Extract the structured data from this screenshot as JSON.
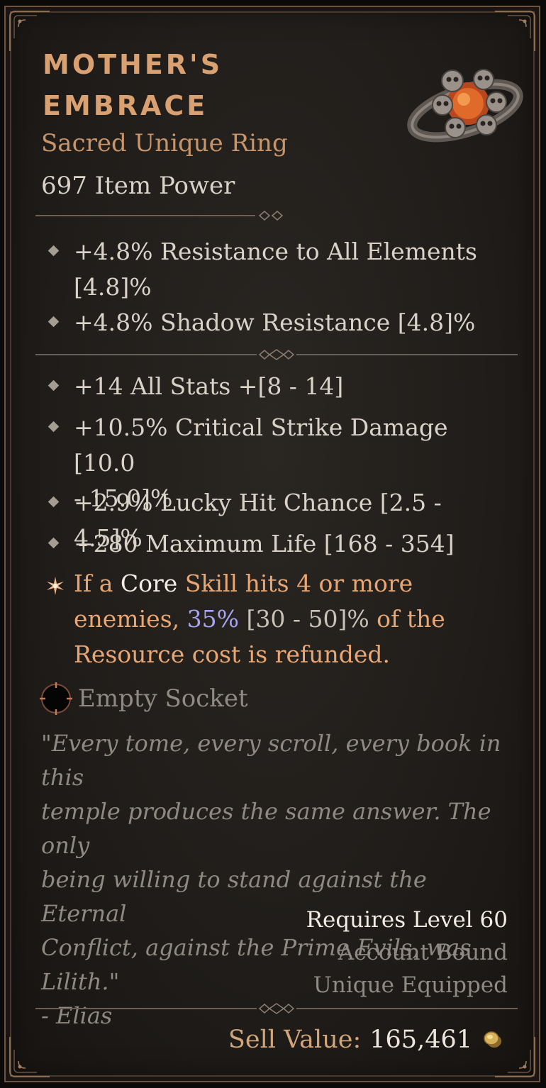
{
  "item": {
    "name_line1": "Mother's",
    "name_line2": "Embrace",
    "type": "Sacred Unique Ring",
    "item_power": "697 Item Power",
    "image_icon": "skull-ring-icon"
  },
  "implicit_affixes": [
    {
      "text_line1": "+4.8% Resistance to All Elements",
      "text_line2": "[4.8]%"
    },
    {
      "text": "+4.8% Shadow Resistance [4.8]%"
    }
  ],
  "affixes": [
    {
      "text": "+14 All Stats +[8 - 14]"
    },
    {
      "text_line1": "+10.5% Critical Strike Damage [10.0",
      "text_line2": "- 15.0]%"
    },
    {
      "text": "+2.9% Lucky Hit Chance [2.5 - 4.5]%"
    },
    {
      "text": "+280 Maximum Life [168 - 354]"
    }
  ],
  "unique_power": {
    "p1": "If a ",
    "core": "Core",
    "p2": " Skill hits 4 or more",
    "p3": "enemies, ",
    "roll": "35%",
    "range": " [30 - 50]%",
    "p4": " of the",
    "p5": "Resource cost is refunded.",
    "icon": "star-burst-icon"
  },
  "socket": {
    "label": "Empty Socket",
    "icon": "socket-icon"
  },
  "flavor": {
    "lines": [
      "\"Every tome, every scroll, every book in this",
      "temple produces the same answer. The only",
      "being willing to stand against the Eternal",
      "Conflict, against the Prime Evils, was Lilith.\"",
      "- Elias"
    ]
  },
  "requirements": {
    "level": "Requires Level 60",
    "bound": "Account Bound",
    "equipped": "Unique Equipped"
  },
  "sell": {
    "label": "Sell Value:",
    "value": "165,461",
    "icon": "gold-coin-icon"
  },
  "colors": {
    "unique_title": "#d9a071",
    "legendary_text": "#e8a674",
    "roll_value": "#a7a4f0",
    "frame": "#6b5442"
  }
}
